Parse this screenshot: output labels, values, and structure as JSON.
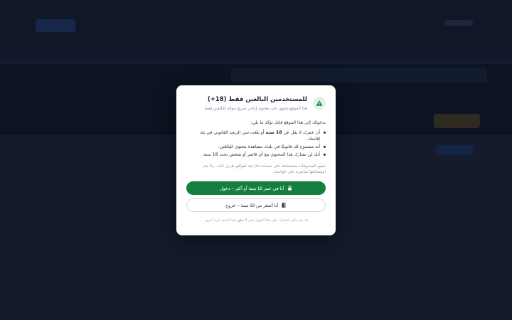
{
  "modal": {
    "title": "للمستخدمين البالغين فقط (18+)",
    "subtitle": "هذا الموقع يحتوي على محتوى إباحي صريح موجّه للبالغين فقط.",
    "intro": "بدخولك إلى هذا الموقع فإنك تؤكد ما يلي:",
    "conditions": {
      "c1_pre": "أن عمرك لا يقل عن ",
      "c1_bold": "18 سنة",
      "c1_post": " أو بلغت سن الرشد القانوني في بلد إقامتك.",
      "c2": "أنه مسموح لك قانونيًا في بلدك مشاهدة محتوى للبالغين.",
      "c3": "أنك لن تشارك هذا المحتوى مع أي قاصر أو شخص تحت 18 سنة."
    },
    "note": "جميع الفيديوهات مستضافة على منصات خارجية لمواقع طرف ثالث، ولا يتم استضافتها مباشرة على خوادمنا.",
    "enter_label": "أنا في عمر 18 سنة أو أكثر – دخول",
    "exit_label": "أنا أصغر من 18 سنة – خروج",
    "footer": "قد يتم تذكر اختيارك على هذا الجهاز حتى لا يظهر هذا التنبيه مرة أخرى."
  },
  "icons": {
    "warning": "warning-icon",
    "lock": "lock-icon",
    "exit": "door-exit-icon"
  },
  "colors": {
    "primary_green": "#15803d",
    "page_background": "#1f2a44"
  }
}
